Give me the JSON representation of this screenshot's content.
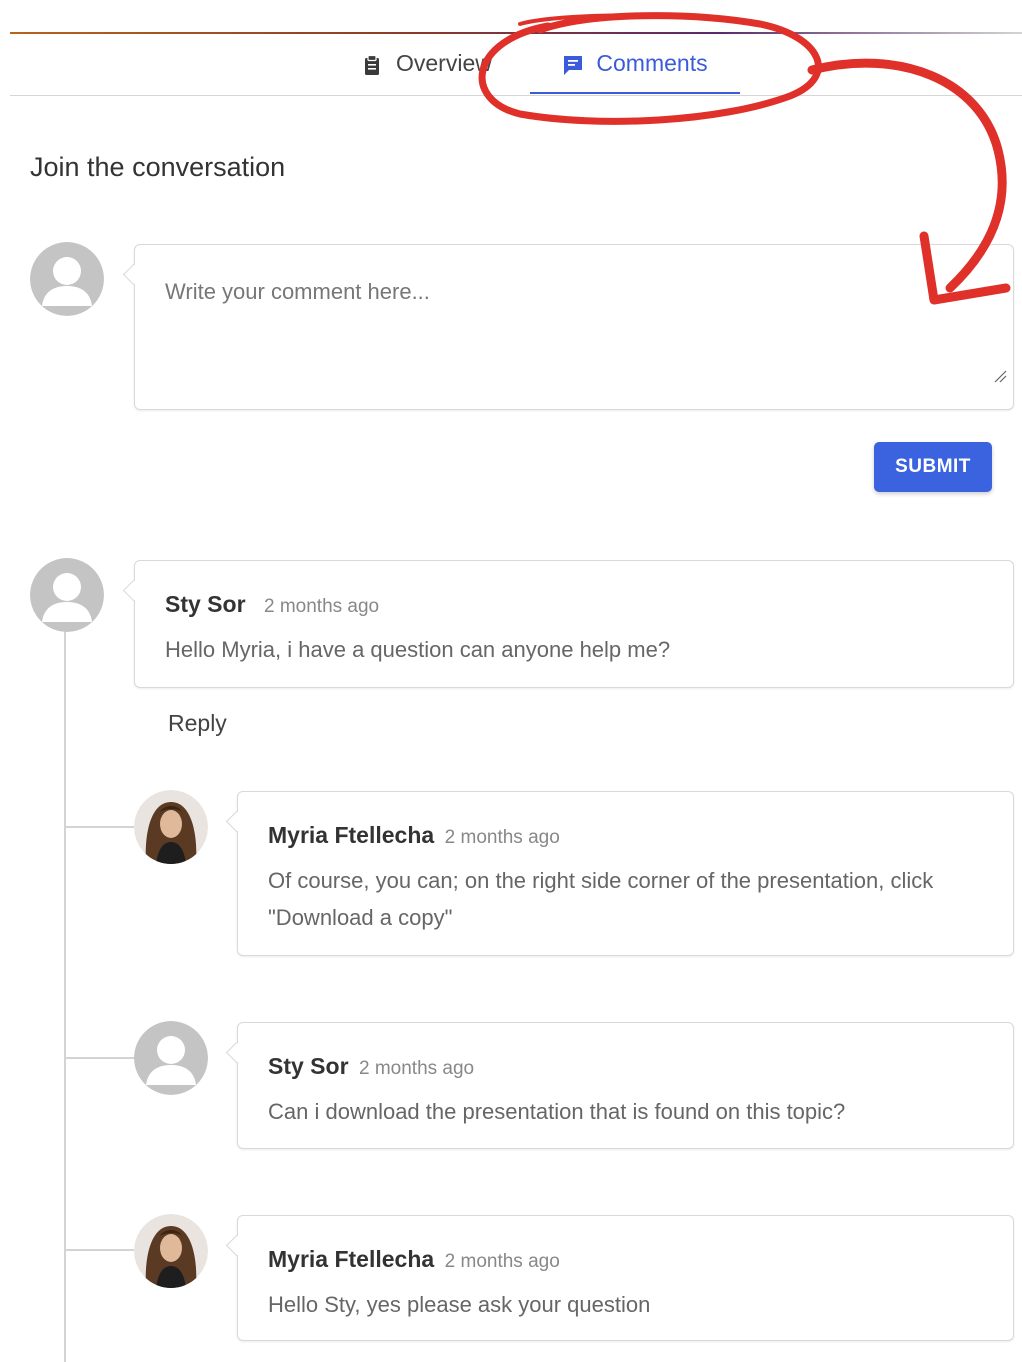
{
  "tabs": [
    {
      "label": "Overview",
      "icon": "clipboard-icon",
      "active": false
    },
    {
      "label": "Comments",
      "icon": "comment-icon",
      "active": true
    }
  ],
  "join_title": "Join the conversation",
  "composer": {
    "placeholder": "Write your comment here...",
    "value": ""
  },
  "submit_label": "SUBMIT",
  "reply_label": "Reply",
  "comments": [
    {
      "author": "Sty Sor",
      "time": "2 months ago",
      "text": "Hello Myria, i have a question can anyone help me?",
      "avatar": "default-avatar-icon"
    },
    {
      "author": "Myria Ftellecha",
      "time": "2 months ago",
      "text": "Of course, you can; on the right side corner of the presentation, click \"Download a copy\"",
      "avatar": "user-photo"
    },
    {
      "author": "Sty Sor",
      "time": "2 months ago",
      "text": "Can i download the presentation that is found on this topic?",
      "avatar": "default-avatar-icon"
    },
    {
      "author": "Myria Ftellecha",
      "time": "2 months ago",
      "text": "Hello Sty, yes please ask your question",
      "avatar": "user-photo"
    }
  ],
  "colors": {
    "accent": "#3b63e0",
    "annotation": "#e0302a",
    "border": "#d9d9d9"
  }
}
